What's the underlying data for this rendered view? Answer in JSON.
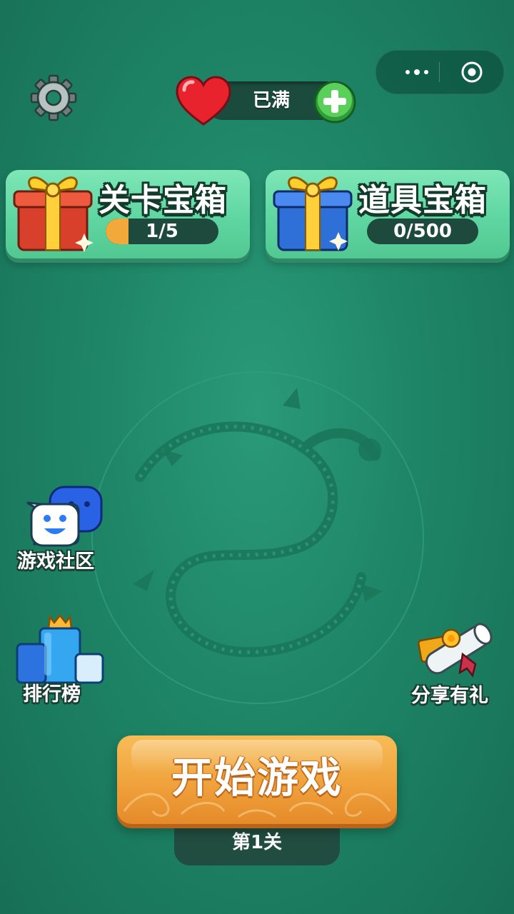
{
  "capsule": {
    "menu_icon": "more-dots-icon",
    "close_icon": "target-close-icon"
  },
  "settings": {
    "icon": "gear-icon"
  },
  "lives": {
    "status": "已满",
    "heart_icon": "heart-icon",
    "add_icon": "plus-icon"
  },
  "chests": [
    {
      "title": "关卡宝箱",
      "progress_text": "1/5",
      "current": 1,
      "total": 5,
      "icon": "red-gift-icon"
    },
    {
      "title": "道具宝箱",
      "progress_text": "0/500",
      "current": 0,
      "total": 500,
      "icon": "blue-gift-icon"
    }
  ],
  "side_buttons": {
    "community": {
      "label": "游戏社区",
      "icon": "chat-bubble-icon"
    },
    "rank": {
      "label": "排行榜",
      "icon": "podium-crown-icon"
    },
    "share": {
      "label": "分享有礼",
      "icon": "scroll-gift-icon"
    }
  },
  "start": {
    "label": "开始游戏",
    "level": "第1关"
  },
  "colors": {
    "background": "#1e8566",
    "card": "#5fd6a1",
    "button": "#f0a23c",
    "progress_fill": "#f2a93a"
  }
}
